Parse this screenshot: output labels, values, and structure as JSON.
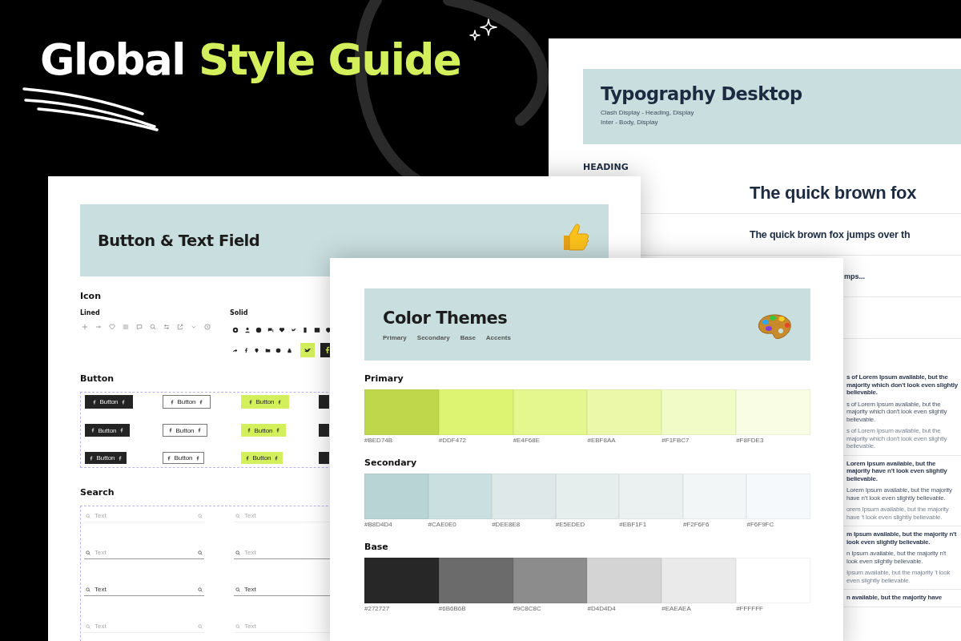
{
  "hero": {
    "title": "Global",
    "title_highlight": "Style Guide"
  },
  "typography_page": {
    "title": "Typography Desktop",
    "fonts": [
      "Clash Display - Heading, Display",
      "Inter - Body, Display"
    ],
    "section": "HEADING",
    "samples": [
      {
        "kind": "h1",
        "text": "The quick brown fox"
      },
      {
        "kind": "h2",
        "text": "The quick brown fox jumps over th"
      },
      {
        "kind": "h3",
        "text": "mps..."
      }
    ],
    "body_groups": [
      [
        {
          "kind": "strong",
          "text": "s of Lorem Ipsum available, but the majority which don't look even slightly believable."
        },
        {
          "kind": "medium",
          "text": "s of Lorem Ipsum available, but the majority which don't look even slightly believable."
        },
        {
          "kind": "light",
          "text": "s of Lorem Ipsum available, but the majority which don't look even slightly believable."
        }
      ],
      [
        {
          "kind": "strong",
          "text": "Lorem Ipsum available, but the majority have n't look even slightly believable."
        },
        {
          "kind": "medium",
          "text": "Lorem Ipsum available, but the majority have n't look even slightly believable."
        },
        {
          "kind": "light",
          "text": "orem Ipsum available, but the majority have 't look even slightly believable."
        }
      ],
      [
        {
          "kind": "strong",
          "text": "m Ipsum available, but the majority n't look even slightly believable."
        },
        {
          "kind": "medium",
          "text": "n Ipsum available, but the majority n't look even slightly believable."
        },
        {
          "kind": "light",
          "text": "Ipsum available, but the majority 't look even slightly believable."
        }
      ],
      [
        {
          "kind": "strong",
          "text": "n available, but the majority have"
        }
      ]
    ]
  },
  "button_page": {
    "title": "Button & Text Field",
    "icon_title": "Icon",
    "lined_label": "Lined",
    "solid_label": "Solid",
    "button_title": "Button",
    "search_title": "Search",
    "button_rows": [
      [
        {
          "kind": "dark",
          "label": "Button"
        },
        {
          "kind": "outline",
          "label": "Button"
        },
        {
          "kind": "lime",
          "label": "Button"
        },
        {
          "kind": "dark"
        }
      ],
      [
        {
          "kind": "dark",
          "label": "Button"
        },
        {
          "kind": "outline",
          "label": "Button"
        },
        {
          "kind": "lime",
          "label": "Button"
        },
        {
          "kind": "dark"
        }
      ],
      [
        {
          "kind": "dark",
          "label": "Button"
        },
        {
          "kind": "outline",
          "label": "Button"
        },
        {
          "kind": "lime",
          "label": "Button"
        },
        {
          "kind": "dark"
        }
      ]
    ],
    "search_rows": [
      [
        {
          "kind": "idle",
          "placeholder": "Text"
        },
        {
          "kind": "idle",
          "placeholder": "Text"
        }
      ],
      [
        {
          "kind": "focus",
          "placeholder": "Text"
        },
        {
          "kind": "focus",
          "placeholder": "Text"
        }
      ],
      [
        {
          "kind": "filled",
          "value": "Text"
        },
        {
          "kind": "filled",
          "value": "Text"
        }
      ],
      [
        {
          "kind": "idle",
          "placeholder": "Text"
        },
        {
          "kind": "idle",
          "placeholder": "Text"
        }
      ]
    ]
  },
  "color_page": {
    "title": "Color Themes",
    "tabs": [
      "Primary",
      "Secondary",
      "Base",
      "Accents"
    ],
    "groups": [
      {
        "title": "Primary",
        "swatches": [
          {
            "hex": "#BED74B",
            "color": "#bed74b"
          },
          {
            "hex": "#DDF472",
            "color": "#ddf472"
          },
          {
            "hex": "#E4F68E",
            "color": "#e4f68e"
          },
          {
            "hex": "#EBF8AA",
            "color": "#ebf8aa"
          },
          {
            "hex": "#F1FBC7",
            "color": "#f1fbc7"
          },
          {
            "hex": "#F8FDE3",
            "color": "#f8fde3"
          }
        ]
      },
      {
        "title": "Secondary",
        "swatches": [
          {
            "hex": "#B8D4D4",
            "color": "#b8d4d4"
          },
          {
            "hex": "#CAE0E0",
            "color": "#cae0e0"
          },
          {
            "hex": "#DEE8E8",
            "color": "#dee8e8"
          },
          {
            "hex": "#E5EDED",
            "color": "#e5eded"
          },
          {
            "hex": "#EBF1F1",
            "color": "#ebf1f1"
          },
          {
            "hex": "#F2F6F6",
            "color": "#f2f6f6"
          },
          {
            "hex": "#F6F9FC",
            "color": "#f6f9fc"
          }
        ]
      },
      {
        "title": "Base",
        "swatches": [
          {
            "hex": "#272727",
            "color": "#272727"
          },
          {
            "hex": "#6B6B6B",
            "color": "#6b6b6b"
          },
          {
            "hex": "#9C8C8C",
            "color": "#8c8c8c"
          },
          {
            "hex": "#D4D4D4",
            "color": "#d4d4d4"
          },
          {
            "hex": "#EAEAEA",
            "color": "#eaeaea"
          },
          {
            "hex": "#FFFFFF",
            "color": "#ffffff"
          }
        ]
      }
    ]
  }
}
